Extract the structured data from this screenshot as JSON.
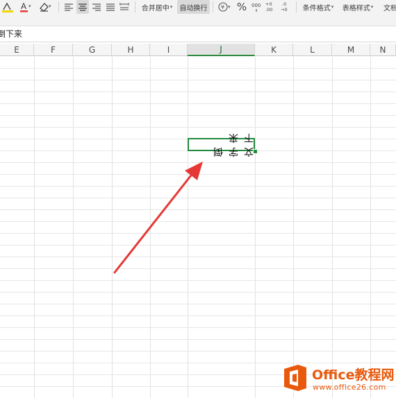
{
  "toolbar": {
    "merge_center": "合并居中",
    "auto_wrap": "自动换行",
    "conditional_format": "条件格式",
    "table_style": "表格样式",
    "doc_partial": "文档"
  },
  "formula_bar": {
    "content": "倒下来"
  },
  "columns": [
    "E",
    "F",
    "G",
    "H",
    "I",
    "J",
    "K",
    "L",
    "M",
    "N"
  ],
  "selected_column": "J",
  "cell": {
    "text": "文字倒下来"
  },
  "watermark": {
    "brand": "Office教程网",
    "url": "www.office26.com"
  },
  "colors": {
    "selection": "#1f8a3b",
    "arrow": "#e53935",
    "brand": "#e8590c"
  }
}
